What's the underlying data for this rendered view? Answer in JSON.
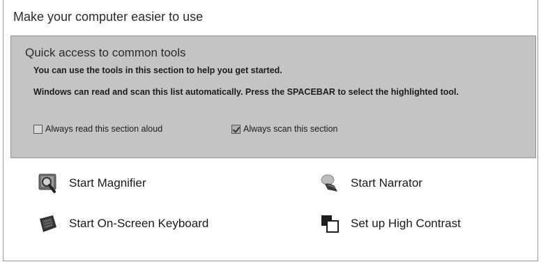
{
  "page": {
    "title": "Make your computer easier to use"
  },
  "quick_access": {
    "title": "Quick access to common tools",
    "description": "You can use the tools in this section to help you get started.",
    "scan_info": "Windows can read and scan this list automatically.  Press the SPACEBAR to select the highlighted tool.",
    "options": {
      "read_aloud": {
        "label": "Always read this section aloud",
        "checked": false
      },
      "scan": {
        "label": "Always scan this section",
        "checked": true
      }
    }
  },
  "tools": {
    "magnifier": {
      "label": "Start Magnifier",
      "icon": "magnifier-icon"
    },
    "narrator": {
      "label": "Start Narrator",
      "icon": "narrator-icon"
    },
    "keyboard": {
      "label": "Start On-Screen Keyboard",
      "icon": "keyboard-icon"
    },
    "contrast": {
      "label": "Set up High Contrast",
      "icon": "high-contrast-icon"
    }
  }
}
